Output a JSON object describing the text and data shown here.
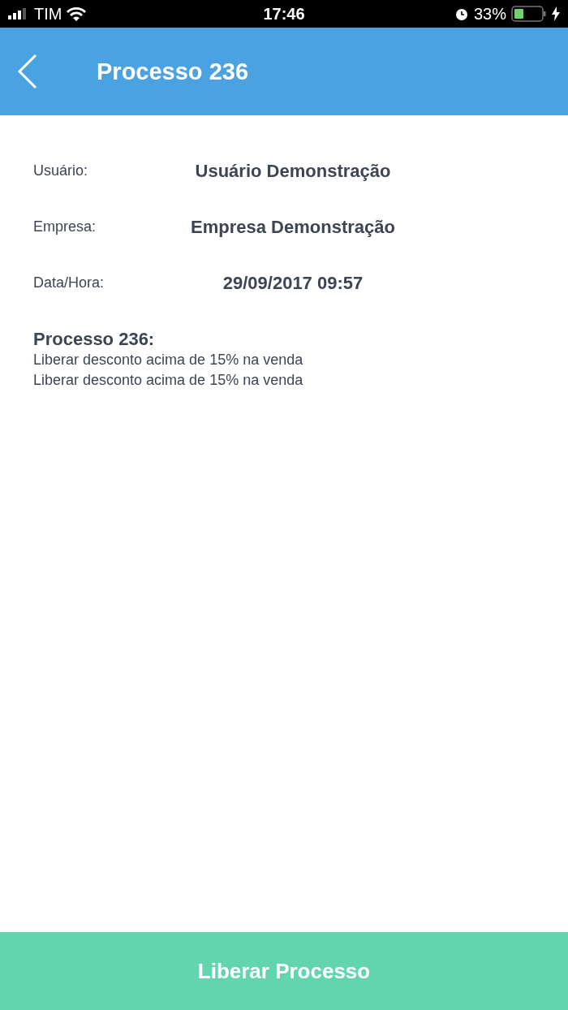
{
  "status_bar": {
    "carrier": "TIM",
    "time": "17:46",
    "battery": "33%"
  },
  "header": {
    "title": "Processo 236"
  },
  "fields": [
    {
      "label": "Usuário:",
      "value": "Usuário Demonstração"
    },
    {
      "label": "Empresa:",
      "value": "Empresa Demonstração"
    },
    {
      "label": "Data/Hora:",
      "value": "29/09/2017 09:57"
    }
  ],
  "process": {
    "title": "Processo 236:",
    "lines": [
      "Liberar desconto acima de 15% na venda",
      "Liberar desconto acima de 15% na venda"
    ]
  },
  "action_button": "Liberar Processo"
}
